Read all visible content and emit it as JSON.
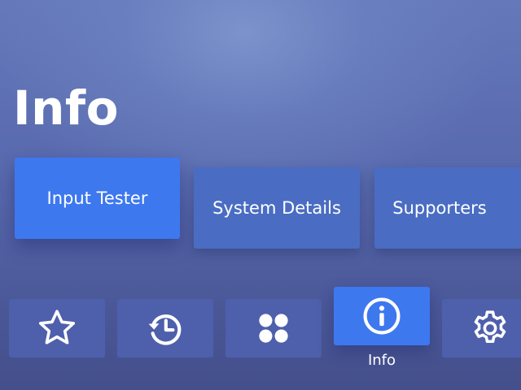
{
  "page": {
    "title": "Info"
  },
  "cards": [
    {
      "label": "Input Tester",
      "focused": true
    },
    {
      "label": "System Details",
      "focused": false
    },
    {
      "label": "Supporters",
      "focused": false
    }
  ],
  "nav": {
    "items": [
      {
        "icon": "star-icon",
        "focused": false
      },
      {
        "icon": "history-icon",
        "focused": false
      },
      {
        "icon": "apps-icon",
        "focused": false
      },
      {
        "icon": "info-icon",
        "focused": true,
        "label": "Info"
      },
      {
        "icon": "gear-icon",
        "focused": false
      }
    ]
  },
  "colors": {
    "focused": "#3d78ef",
    "card": "#4a6dc3",
    "nav_tile": "#4e5fac",
    "text": "#ffffff"
  }
}
